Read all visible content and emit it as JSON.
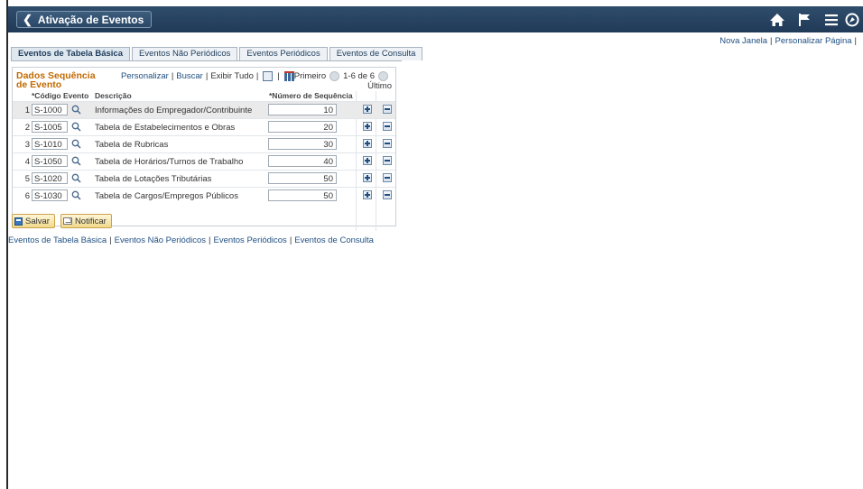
{
  "header": {
    "back_label": "Ativação de Eventos",
    "icons": [
      "home-icon",
      "flag-icon",
      "menu-icon",
      "navbar-icon"
    ]
  },
  "top_links": {
    "new_window": "Nova Janela",
    "personalize_page": "Personalizar Página"
  },
  "tabs": [
    {
      "label": "Eventos de Tabela Básica",
      "active": true
    },
    {
      "label": "Eventos Não Periódicos",
      "active": false
    },
    {
      "label": "Eventos Periódicos",
      "active": false
    },
    {
      "label": "Eventos de Consulta",
      "active": false
    }
  ],
  "grid": {
    "title": "Dados Sequência de Evento",
    "tools": {
      "personalize": "Personalizar",
      "search": "Buscar",
      "show_all": "Exibir Tudo"
    },
    "nav": {
      "first": "Primeiro",
      "range": "1-6 de 6",
      "last": "Último"
    },
    "columns": {
      "code": "*Código Evento",
      "description": "Descrição",
      "sequence": "*Número de Sequência"
    },
    "rows": [
      {
        "n": "1",
        "code": "S-1000",
        "description": "Informações do Empregador/Contribuinte",
        "sequence": "10"
      },
      {
        "n": "2",
        "code": "S-1005",
        "description": "Tabela de Estabelecimentos e Obras",
        "sequence": "20"
      },
      {
        "n": "3",
        "code": "S-1010",
        "description": "Tabela de Rubricas",
        "sequence": "30"
      },
      {
        "n": "4",
        "code": "S-1050",
        "description": "Tabela de Horários/Turnos de Trabalho",
        "sequence": "40"
      },
      {
        "n": "5",
        "code": "S-1020",
        "description": "Tabela de Lotações Tributárias",
        "sequence": "50"
      },
      {
        "n": "6",
        "code": "S-1030",
        "description": "Tabela de Cargos/Empregos Públicos",
        "sequence": "50"
      }
    ]
  },
  "actions": {
    "save": "Salvar",
    "notify": "Notificar"
  },
  "bottom_links": [
    "Eventos de Tabela Básica",
    "Eventos Não Periódicos",
    "Eventos Periódicos",
    "Eventos de Consulta"
  ],
  "colors": {
    "header_bg": "#203a57",
    "link": "#1f4f82",
    "grid_title": "#c16a00"
  }
}
